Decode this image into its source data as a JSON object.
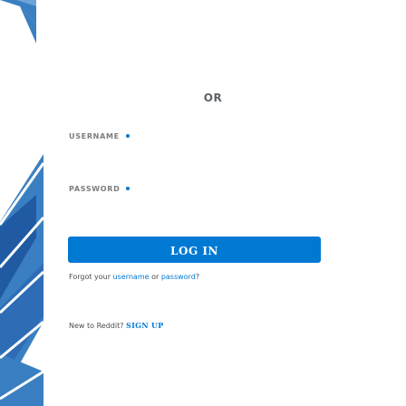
{
  "divider": {
    "label": "OR"
  },
  "username": {
    "label": "USERNAME",
    "value": ""
  },
  "password": {
    "label": "PASSWORD",
    "value": ""
  },
  "login_button": {
    "label": "LOG IN"
  },
  "forgot": {
    "prefix": "Forgot your ",
    "username_link": "username",
    "middle": " or ",
    "password_link": "password",
    "suffix": "?"
  },
  "signup": {
    "prompt": "New to Reddit?",
    "link": "SIGN UP"
  },
  "colors": {
    "accent": "#0079d3",
    "art_blue": "#3a7fc1",
    "art_white": "#ffffff"
  },
  "icons": {
    "required_marker": "dot"
  }
}
